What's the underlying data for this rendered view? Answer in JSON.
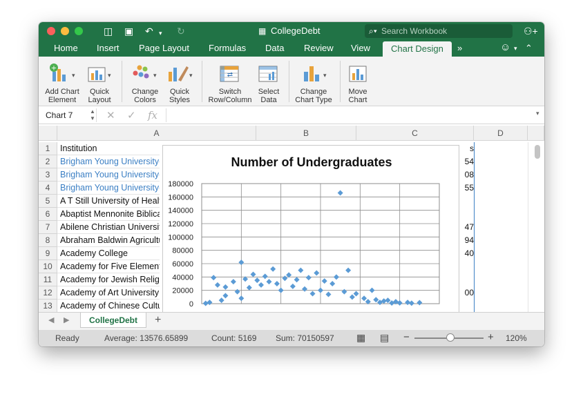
{
  "app": {
    "title": "CollegeDebt",
    "search_placeholder": "Search Workbook"
  },
  "tabs": [
    {
      "label": "Home"
    },
    {
      "label": "Insert"
    },
    {
      "label": "Page Layout"
    },
    {
      "label": "Formulas"
    },
    {
      "label": "Data"
    },
    {
      "label": "Review"
    },
    {
      "label": "View"
    },
    {
      "label": "Chart Design"
    }
  ],
  "ribbon": {
    "add_chart_element": [
      "Add Chart",
      "Element"
    ],
    "quick_layout": [
      "Quick",
      "Layout"
    ],
    "change_colors": [
      "Change",
      "Colors"
    ],
    "quick_styles": [
      "Quick",
      "Styles"
    ],
    "switch_row_column": [
      "Switch",
      "Row/Column"
    ],
    "select_data": [
      "Select",
      "Data"
    ],
    "change_chart_type": [
      "Change",
      "Chart Type"
    ],
    "move_chart": [
      "Move",
      "Chart"
    ]
  },
  "formula_bar": {
    "name_box": "Chart 7",
    "fx": "fx"
  },
  "columns": [
    "A",
    "B",
    "C",
    "D"
  ],
  "rows": [
    {
      "num": "1",
      "a": "Institution",
      "link": false,
      "right": "s"
    },
    {
      "num": "2",
      "a": "Brigham Young University-Idaho",
      "link": true,
      "right": "54"
    },
    {
      "num": "3",
      "a": "Brigham Young University-Provo",
      "link": true,
      "right": "08"
    },
    {
      "num": "4",
      "a": "Brigham Young University-Hawaii",
      "link": true,
      "right": "55"
    },
    {
      "num": "5",
      "a": "A T Still University of Health Sciences",
      "link": false,
      "right": ""
    },
    {
      "num": "6",
      "a": "Abaptist Mennonite Biblical Seminary",
      "link": false,
      "right": ""
    },
    {
      "num": "7",
      "a": "Abilene Christian University",
      "link": false,
      "right": "47"
    },
    {
      "num": "8",
      "a": "Abraham Baldwin Agricultural College",
      "link": false,
      "right": "94"
    },
    {
      "num": "9",
      "a": "Academy College",
      "link": false,
      "right": "40"
    },
    {
      "num": "10",
      "a": "Academy for Five Element Acupuncture",
      "link": false,
      "right": ""
    },
    {
      "num": "11",
      "a": "Academy for Jewish Religion",
      "link": false,
      "right": ""
    },
    {
      "num": "12",
      "a": "Academy of Art University",
      "link": false,
      "right": "00"
    },
    {
      "num": "13",
      "a": "Academy of Chinese Culture and Health Sciences",
      "link": false,
      "right": ""
    }
  ],
  "chart_data": {
    "type": "scatter",
    "title": "Number of Undergraduates",
    "ylim": [
      0,
      180000
    ],
    "yticks": [
      "0",
      "20000",
      "40000",
      "60000",
      "80000",
      "100000",
      "120000",
      "140000",
      "160000",
      "180000"
    ],
    "marker": "diamond",
    "color": "#5b9bd5",
    "x_range": [
      0,
      6000
    ],
    "points": [
      [
        3500,
        166000
      ],
      [
        1000,
        62000
      ],
      [
        1800,
        52000
      ],
      [
        3700,
        50000
      ],
      [
        2500,
        50000
      ],
      [
        2900,
        46000
      ],
      [
        1300,
        44000
      ],
      [
        300,
        39000
      ],
      [
        2200,
        43000
      ],
      [
        1600,
        41000
      ],
      [
        3400,
        40000
      ],
      [
        4300,
        20000
      ],
      [
        400,
        28000
      ],
      [
        800,
        33000
      ],
      [
        1100,
        37000
      ],
      [
        1400,
        35000
      ],
      [
        2100,
        38000
      ],
      [
        2400,
        36000
      ],
      [
        2700,
        39000
      ],
      [
        3100,
        34000
      ],
      [
        3300,
        30000
      ],
      [
        3600,
        18000
      ],
      [
        3900,
        15000
      ],
      [
        4100,
        8000
      ],
      [
        4400,
        6000
      ],
      [
        4600,
        4000
      ],
      [
        4900,
        3000
      ],
      [
        5200,
        2000
      ],
      [
        5500,
        1500
      ],
      [
        5000,
        1200
      ],
      [
        4700,
        5000
      ],
      [
        200,
        2000
      ],
      [
        600,
        12000
      ],
      [
        900,
        18000
      ],
      [
        1200,
        24000
      ],
      [
        1500,
        28000
      ],
      [
        1900,
        30000
      ],
      [
        2300,
        26000
      ],
      [
        2600,
        22000
      ],
      [
        3000,
        20000
      ],
      [
        3200,
        14000
      ],
      [
        3800,
        10000
      ],
      [
        4200,
        3000
      ],
      [
        4500,
        2000
      ],
      [
        4800,
        1000
      ],
      [
        5300,
        800
      ],
      [
        600,
        25000
      ],
      [
        1700,
        33000
      ],
      [
        2000,
        20000
      ],
      [
        2800,
        15000
      ],
      [
        1000,
        8000
      ],
      [
        500,
        5000
      ],
      [
        100,
        500
      ]
    ]
  },
  "sheet_tab": "CollegeDebt",
  "status": {
    "ready": "Ready",
    "average": "Average: 13576.65899",
    "count": "Count: 5169",
    "sum": "Sum: 70150597",
    "zoom": "120%",
    "zoom_minus": "−",
    "zoom_plus": "+"
  },
  "icons": {
    "undo": "undo-icon",
    "redo": "redo-icon",
    "save": "save-icon",
    "sidebar": "sidebar-icon"
  }
}
